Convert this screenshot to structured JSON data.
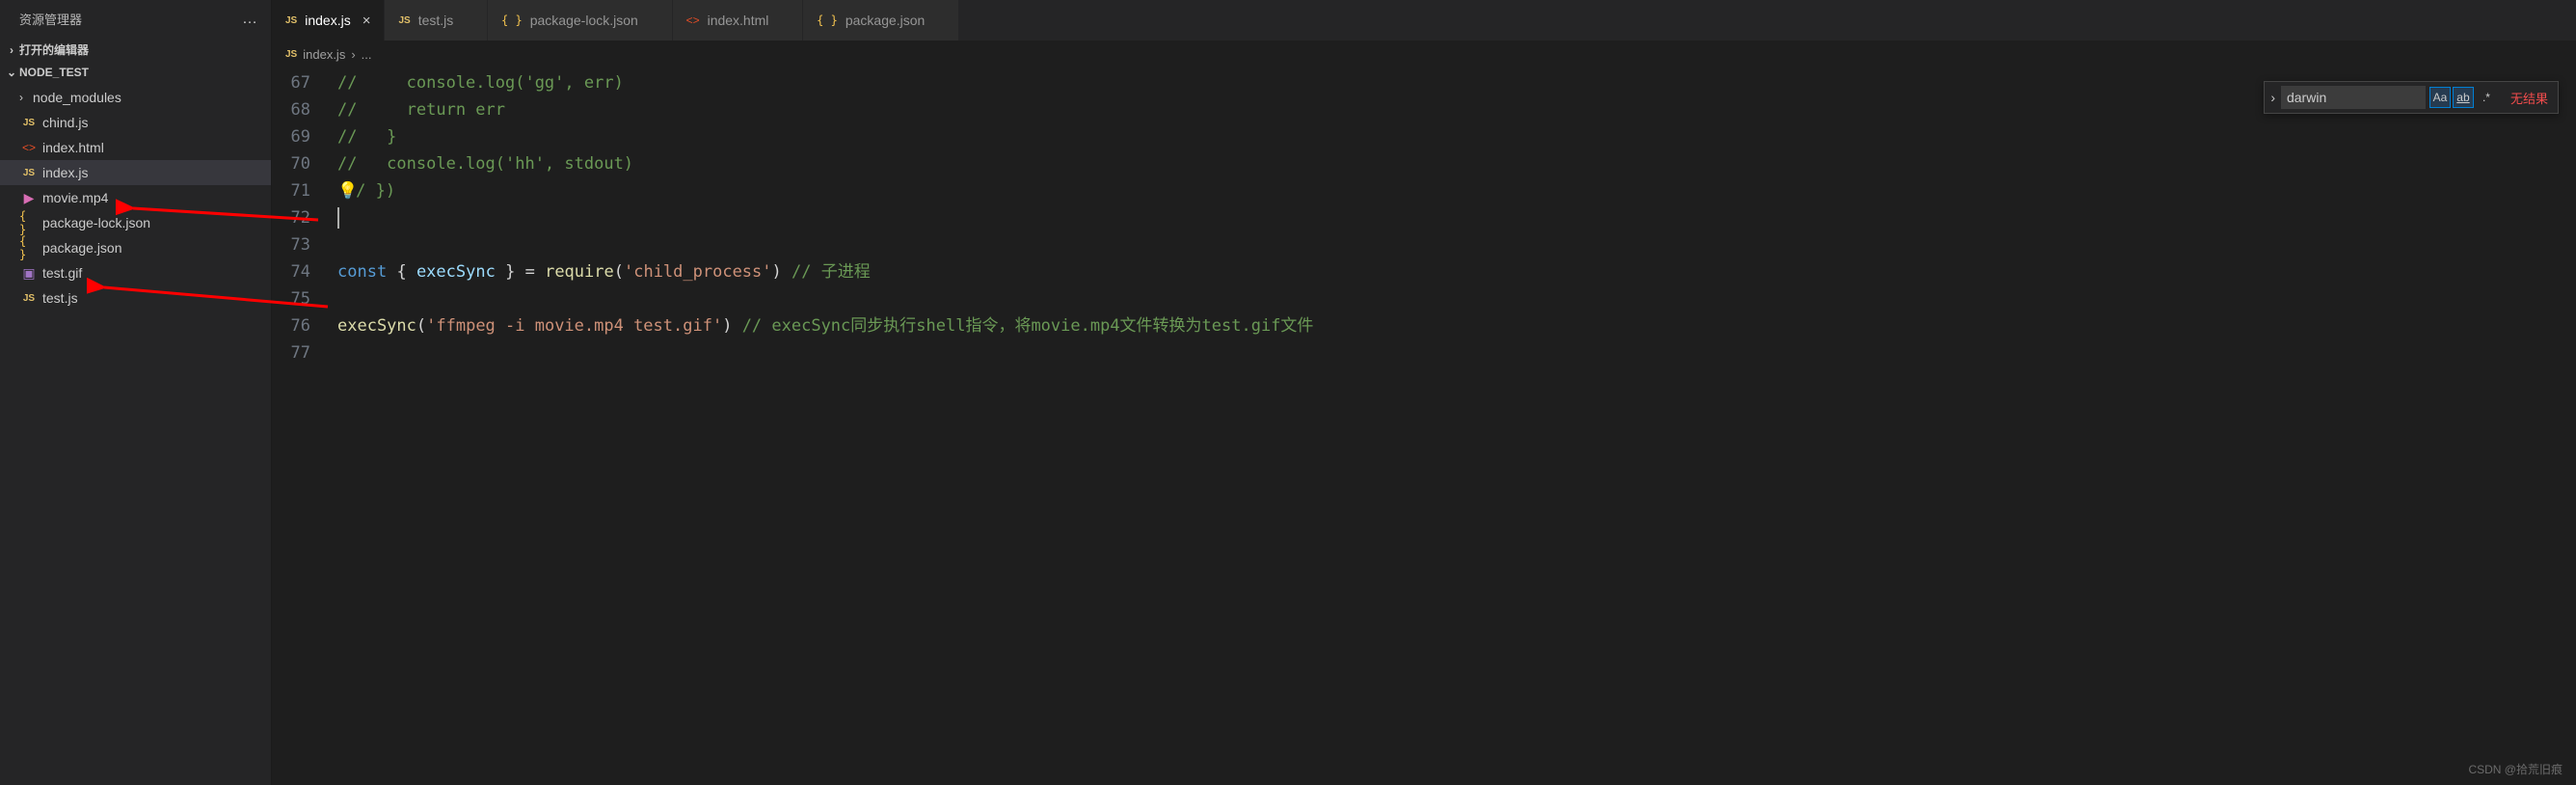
{
  "sidebar": {
    "title": "资源管理器",
    "section_open": "打开的编辑器",
    "project": "NODE_TEST",
    "items": [
      {
        "icon": "chevron",
        "name": "node_modules"
      },
      {
        "icon": "js",
        "name": "chind.js"
      },
      {
        "icon": "html",
        "name": "index.html"
      },
      {
        "icon": "js",
        "name": "index.js",
        "selected": true
      },
      {
        "icon": "video",
        "name": "movie.mp4"
      },
      {
        "icon": "json",
        "name": "package-lock.json"
      },
      {
        "icon": "json",
        "name": "package.json"
      },
      {
        "icon": "image",
        "name": "test.gif"
      },
      {
        "icon": "js",
        "name": "test.js"
      }
    ]
  },
  "tabs": [
    {
      "icon": "js",
      "label": "index.js",
      "active": true
    },
    {
      "icon": "js",
      "label": "test.js"
    },
    {
      "icon": "json",
      "label": "package-lock.json"
    },
    {
      "icon": "html",
      "label": "index.html"
    },
    {
      "icon": "json",
      "label": "package.json"
    }
  ],
  "breadcrumb": {
    "icon": "js",
    "file": "index.js",
    "sep": "›",
    "rest": "..."
  },
  "code": {
    "lines": [
      {
        "n": 67,
        "segs": [
          {
            "t": "//     console.log('gg', err)",
            "c": "cm"
          }
        ]
      },
      {
        "n": 68,
        "segs": [
          {
            "t": "//     return err",
            "c": "cm"
          }
        ]
      },
      {
        "n": 69,
        "segs": [
          {
            "t": "//   }",
            "c": "cm"
          }
        ]
      },
      {
        "n": 70,
        "segs": [
          {
            "t": "//   console.log('hh', stdout)",
            "c": "cm"
          }
        ]
      },
      {
        "n": 71,
        "segs": [
          {
            "t": "💡",
            "c": "lightbulb"
          },
          {
            "t": "/ })",
            "c": "cm"
          }
        ]
      },
      {
        "n": 72,
        "segs": [],
        "cursor": true
      },
      {
        "n": 73,
        "segs": []
      },
      {
        "n": 74,
        "segs": [
          {
            "t": "const",
            "c": "kw"
          },
          {
            "t": " ",
            "c": "pn"
          },
          {
            "t": "{",
            "c": "pn"
          },
          {
            "t": " ",
            "c": "pn"
          },
          {
            "t": "execSync",
            "c": "vr"
          },
          {
            "t": " ",
            "c": "pn"
          },
          {
            "t": "}",
            "c": "pn"
          },
          {
            "t": " ",
            "c": "pn"
          },
          {
            "t": "=",
            "c": "op"
          },
          {
            "t": " ",
            "c": "pn"
          },
          {
            "t": "require",
            "c": "fn"
          },
          {
            "t": "(",
            "c": "pn"
          },
          {
            "t": "'child_process'",
            "c": "str"
          },
          {
            "t": ")",
            "c": "pn"
          },
          {
            "t": " ",
            "c": "pn"
          },
          {
            "t": "// 子进程",
            "c": "cm"
          }
        ]
      },
      {
        "n": 75,
        "segs": []
      },
      {
        "n": 76,
        "segs": [
          {
            "t": "execSync",
            "c": "fn"
          },
          {
            "t": "(",
            "c": "pn"
          },
          {
            "t": "'ffmpeg -i movie.mp4 test.gif'",
            "c": "str"
          },
          {
            "t": ")",
            "c": "pn"
          },
          {
            "t": " ",
            "c": "pn"
          },
          {
            "t": "// execSync同步执行shell指令，将movie.mp4文件转换为test.gif文件",
            "c": "cm"
          }
        ]
      },
      {
        "n": 77,
        "segs": []
      }
    ]
  },
  "find": {
    "value": "darwin",
    "opts": {
      "case": "Aa",
      "word": "ab",
      "regex": ".*"
    },
    "results": "无结果"
  },
  "watermark": "CSDN @拾荒旧痕"
}
